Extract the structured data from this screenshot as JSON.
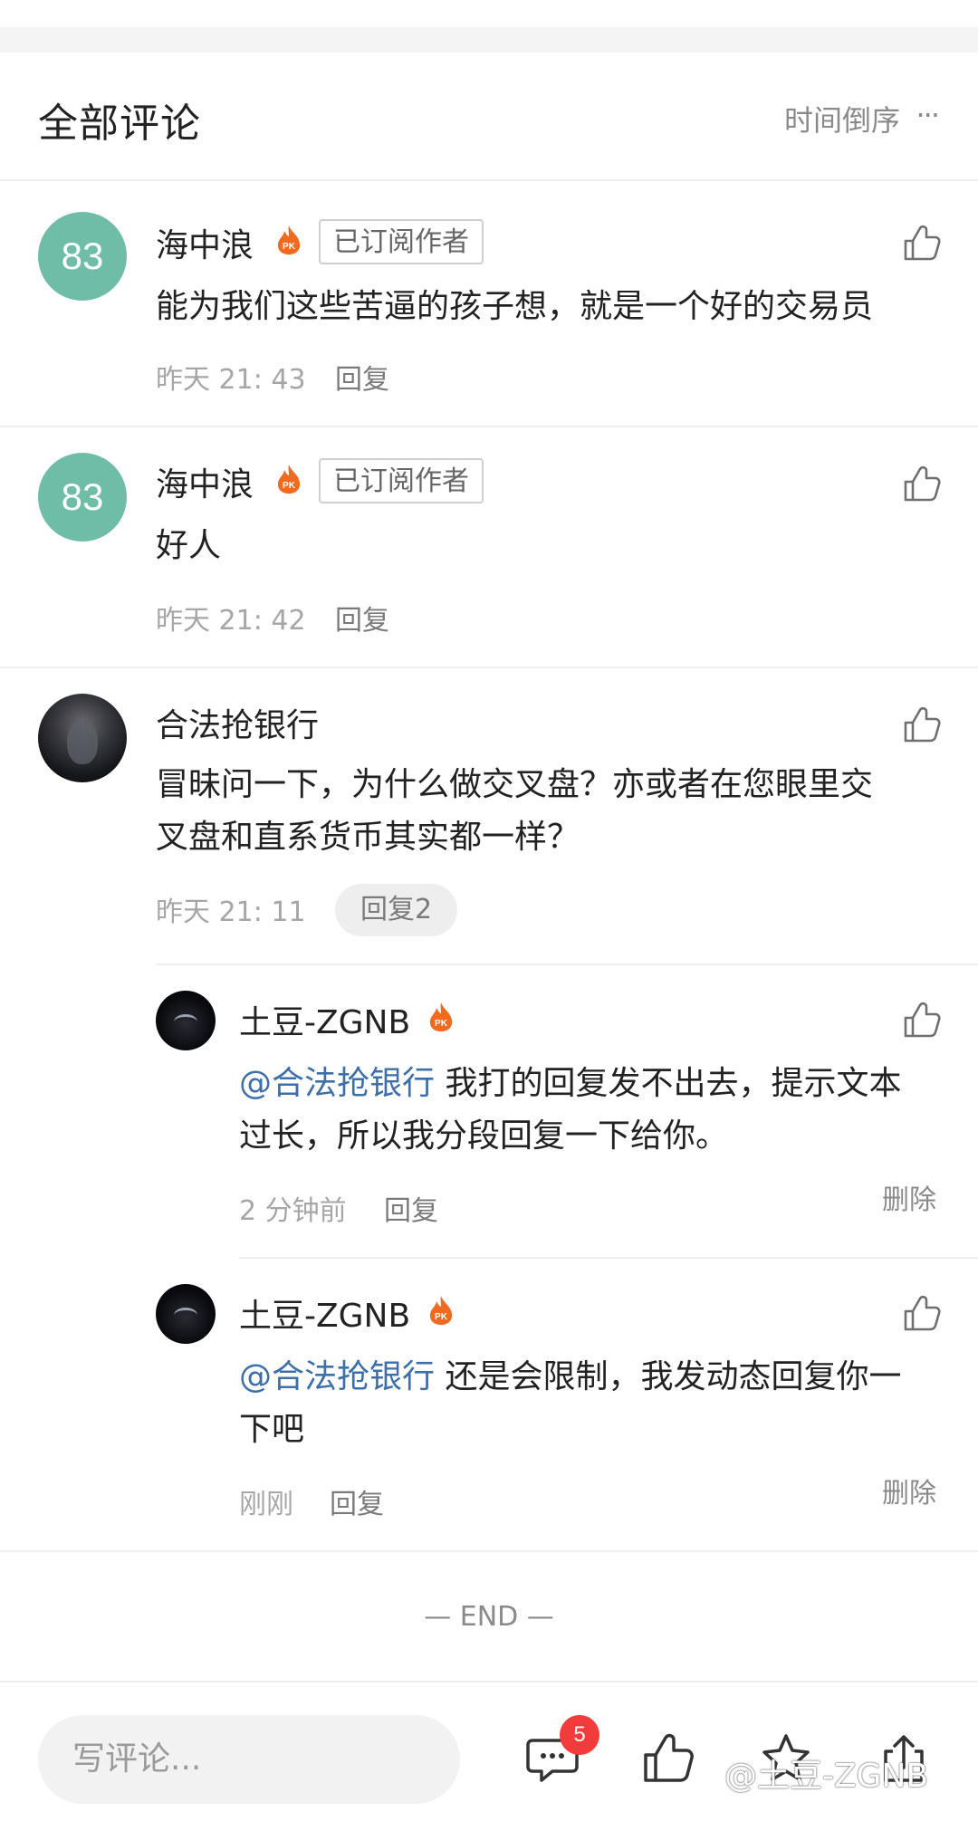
{
  "header": {
    "title": "全部评论",
    "sort_label": "时间倒序",
    "more_label": "···"
  },
  "comments": [
    {
      "avatar_text": "83",
      "name": "海中浪",
      "badge": "已订阅作者",
      "text": "能为我们这些苦逼的孩子想，就是一个好的交易员",
      "time": "昨天 21: 43",
      "reply": "回复"
    },
    {
      "avatar_text": "83",
      "name": "海中浪",
      "badge": "已订阅作者",
      "text": "好人",
      "time": "昨天 21: 42",
      "reply": "回复"
    },
    {
      "name": "合法抢银行",
      "text_line1": "冒昧问一下，为什么做交叉盘？亦或者在您眼里交",
      "text_line2": "叉盘和直系货币其实都一样？",
      "time": "昨天 21: 11",
      "reply": "回复2",
      "replies": [
        {
          "name": "土豆-ZGNB",
          "mention": "@合法抢银行",
          "text_line1": " 我打的回复发不出去，提示文本",
          "text_line2": "过长，所以我分段回复一下给你。",
          "time": "2 分钟前",
          "reply": "回复",
          "delete": "删除"
        },
        {
          "name": "土豆-ZGNB",
          "mention": "@合法抢银行",
          "text_line1": " 还是会限制，我发动态回复你一",
          "text_line2": "下吧",
          "time": "刚刚",
          "reply": "回复",
          "delete": "删除"
        }
      ]
    }
  ],
  "end_label": "— END —",
  "bottom_bar": {
    "write_placeholder": "写评论...",
    "comment_count": "5",
    "watermark": "@土豆-ZGNB"
  },
  "icons": [
    "pk-fire-icon",
    "thumb-up-icon",
    "comment-icon",
    "star-icon",
    "share-icon"
  ],
  "colors": {
    "avatar_green": "#6fbda6",
    "mention_blue": "#3d6fa8",
    "badge_red": "#f43b3b",
    "pk_orange": "#f06a1f"
  }
}
